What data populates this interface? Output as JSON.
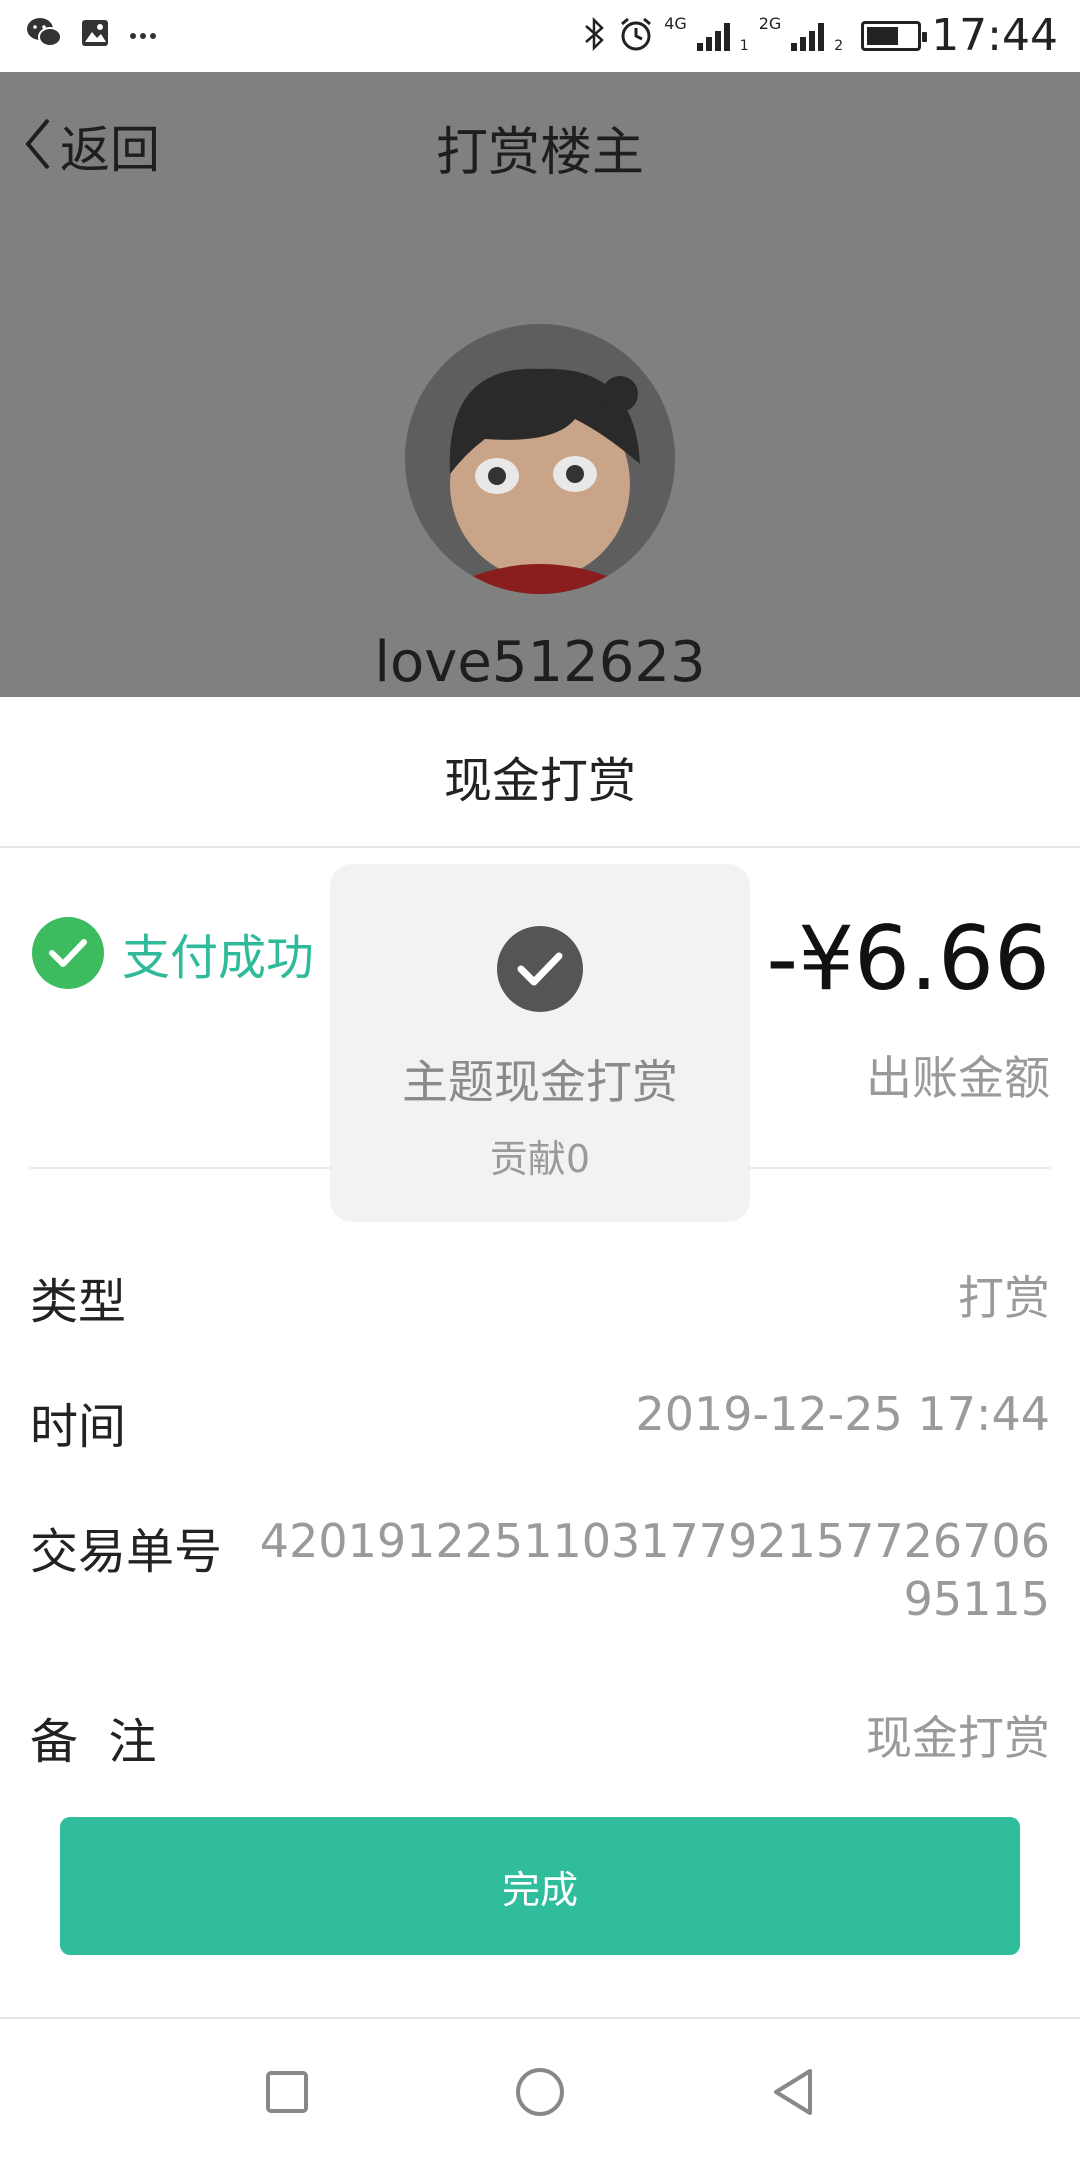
{
  "status_bar": {
    "time": "17:44",
    "network1": "4G",
    "sim1": "1",
    "network2": "2G",
    "sim2": "2",
    "battery_level": 0.65,
    "left_icons": [
      "wechat-icon",
      "image-icon",
      "more-dots-icon"
    ],
    "right_icons": [
      "bluetooth-icon",
      "alarm-icon",
      "signal-icon",
      "battery-icon"
    ]
  },
  "header": {
    "back_label": "返回",
    "title": "打赏楼主"
  },
  "profile": {
    "username": "love512623"
  },
  "sheet": {
    "title": "现金打赏",
    "status_text": "支付成功",
    "amount": "-¥6.66",
    "amount_label": "出账金额",
    "rows": {
      "type": {
        "label": "类型",
        "value": "打赏"
      },
      "time": {
        "label": "时间",
        "value": "2019-12-25 17:44"
      },
      "order": {
        "label": "交易单号",
        "value": "42019122511031779215772670695115"
      },
      "note": {
        "label": "备  注",
        "value": "现金打赏"
      }
    },
    "done_button": "完成"
  },
  "toast": {
    "title": "主题现金打赏",
    "subtitle": "贡献0"
  },
  "colors": {
    "accent": "#2fbd9b",
    "success": "#3cbb5f",
    "overlay": "#808080"
  }
}
